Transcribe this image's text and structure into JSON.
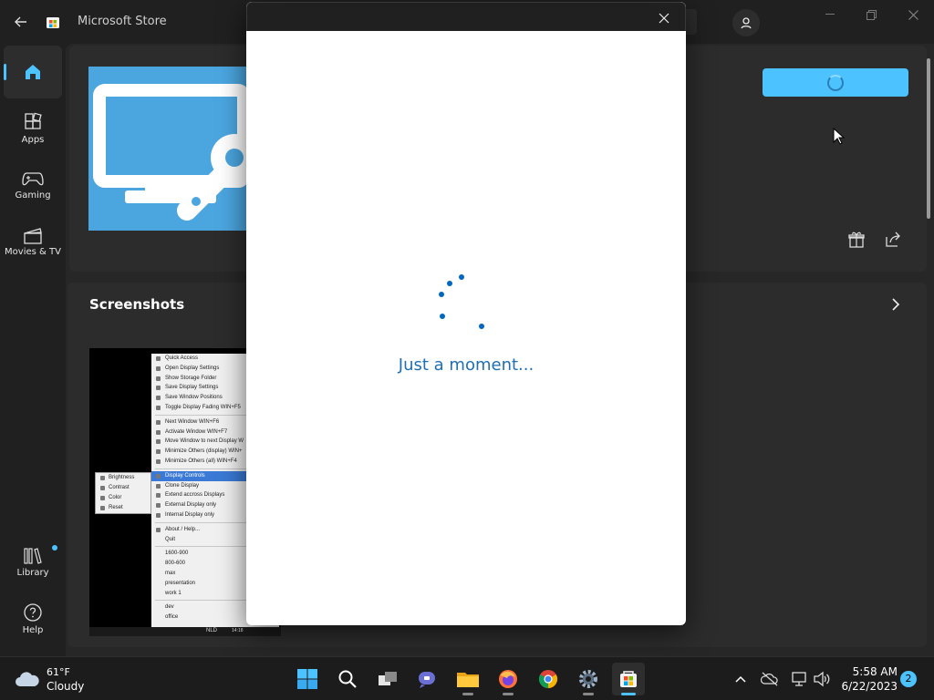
{
  "app": {
    "title": "Microsoft Store"
  },
  "nav": {
    "home": "",
    "apps": "Apps",
    "gaming": "Gaming",
    "movies": "Movies & TV",
    "library": "Library",
    "help": "Help"
  },
  "sections": {
    "screenshots": "Screenshots"
  },
  "dialog": {
    "message": "Just a moment..."
  },
  "screenshot_menu": {
    "group1": [
      "Quick Access",
      "Open Display Settings",
      "Show Storage Folder",
      "Save Display Settings",
      "Save Window Positions",
      "Toggle Display Fading  WIN+F5"
    ],
    "group2": [
      "Next Window  WIN+F6",
      "Activate Window  WIN+F7",
      "Move Window to next Display  W",
      "Minimize Others (display)  WIN+",
      "Minimize Others (all)  WIN+F4"
    ],
    "group3": [
      "Display Controls",
      "Clone Display",
      "Extend accross Displays",
      "External Display only",
      "Internal Display only"
    ],
    "group4": [
      "About / Help...",
      "Quit"
    ],
    "group5": [
      "1600-900",
      "800-600",
      "max",
      "presentation",
      "work 1"
    ],
    "group6": [
      "dev",
      "office"
    ],
    "submenu": [
      "Brightness",
      "Contrast",
      "Color",
      "Reset"
    ],
    "taskbar_text": "NLD",
    "taskbar_time": "14:18"
  },
  "taskbar": {
    "weather_temp": "61°F",
    "weather_cond": "Cloudy",
    "time": "5:58 AM",
    "date": "6/22/2023",
    "notifications": "2"
  },
  "colors": {
    "accent": "#4cc2ff",
    "loader": "#0067c0",
    "moment_text": "#1f6fb2"
  }
}
